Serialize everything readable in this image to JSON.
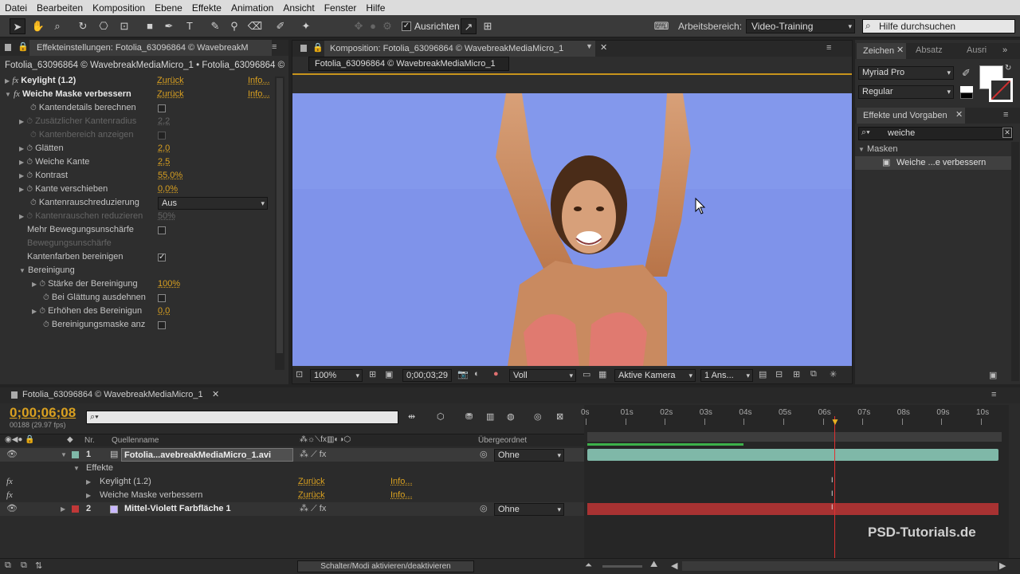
{
  "menu": [
    "Datei",
    "Bearbeiten",
    "Komposition",
    "Ebene",
    "Effekte",
    "Animation",
    "Ansicht",
    "Fenster",
    "Hilfe"
  ],
  "toolbar": {
    "ausrichten": "Ausrichten",
    "arbeitsbereich_label": "Arbeitsbereich:",
    "arbeitsbereich_value": "Video-Training",
    "help_placeholder": "Hilfe durchsuchen"
  },
  "effects_panel": {
    "tab": "Effekteinstellungen: Fotolia_63096864 © WavebreakM",
    "subtitle": "Fotolia_63096864 © WavebreakMediaMicro_1 • Fotolia_63096864 © WavebreakM",
    "keylight": {
      "name": "Keylight (1.2)",
      "reset": "Zurück",
      "info": "Info..."
    },
    "weiche": {
      "name": "Weiche Maske verbessern",
      "reset": "Zurück",
      "info": "Info..."
    },
    "props": [
      {
        "label": "Kantendetails berechnen",
        "value": ""
      },
      {
        "label": "Zusätzlicher Kantenradius",
        "value": "2,2"
      },
      {
        "label": "Kantenbereich anzeigen",
        "value": ""
      },
      {
        "label": "Glätten",
        "value": "2,0"
      },
      {
        "label": "Weiche Kante",
        "value": "2,5"
      },
      {
        "label": "Kontrast",
        "value": "55,0%"
      },
      {
        "label": "Kante verschieben",
        "value": "0,0%"
      },
      {
        "label": "Kantenrauschreduzierung",
        "value": "Aus"
      },
      {
        "label": "Kantenrauschen reduzieren",
        "value": "50%"
      },
      {
        "label": "Mehr Bewegungsunschärfe",
        "value": ""
      },
      {
        "label": "Bewegungsunschärfe",
        "value": ""
      },
      {
        "label": "Kantenfarben bereinigen",
        "value": ""
      },
      {
        "label": "Bereinigung",
        "value": ""
      },
      {
        "label": "Stärke der Bereinigung",
        "value": "100%"
      },
      {
        "label": "Bei Glättung ausdehnen",
        "value": ""
      },
      {
        "label": "Erhöhen des Bereinigun",
        "value": "0,0"
      },
      {
        "label": "Bereinigungsmaske anz",
        "value": ""
      }
    ]
  },
  "composition": {
    "tab": "Komposition: Fotolia_63096864 © WavebreakMediaMicro_1",
    "subtab": "Fotolia_63096864 © WavebreakMediaMicro_1",
    "zoom": "100%",
    "timecode": "0;00;03;29",
    "resolution": "Voll",
    "camera": "Aktive Kamera",
    "views": "1 Ans..."
  },
  "right_panel": {
    "tabs": [
      "Zeichen",
      "Absatz",
      "Ausri"
    ],
    "font": "Myriad Pro",
    "style": "Regular",
    "effects_tab": "Effekte und Vorgaben",
    "search_value": "weiche",
    "category": "Masken",
    "result": "Weiche ...e verbessern"
  },
  "timeline": {
    "tab": "Fotolia_63096864 © WavebreakMediaMicro_1",
    "timecode": "0;00;06;08",
    "frames": "00188 (29.97 fps)",
    "col_nr": "Nr.",
    "col_source": "Quellenname",
    "col_parent": "Übergeordnet",
    "ruler": [
      "0s",
      "01s",
      "02s",
      "03s",
      "04s",
      "05s",
      "06s",
      "07s",
      "08s",
      "09s",
      "10s"
    ],
    "layers": [
      {
        "nr": "1",
        "name": "Fotolia...avebreakMediaMicro_1.avi",
        "parent": "Ohne"
      },
      {
        "nr": "2",
        "name": "Mittel-Violett Farbfläche 1",
        "parent": "Ohne"
      }
    ],
    "effekte_label": "Effekte",
    "fx_rows": [
      {
        "name": "Keylight (1.2)",
        "reset": "Zurück",
        "info": "Info..."
      },
      {
        "name": "Weiche Maske verbessern",
        "reset": "Zurück",
        "info": "Info..."
      }
    ],
    "toggle_label": "Schalter/Modi aktivieren/deaktivieren",
    "watermark": "PSD-Tutorials.de"
  },
  "colors": {
    "accent": "#d9a020",
    "layer1": "#7fb8a8",
    "layer2": "#b03030",
    "viewer_bg": "#7f93ea"
  }
}
